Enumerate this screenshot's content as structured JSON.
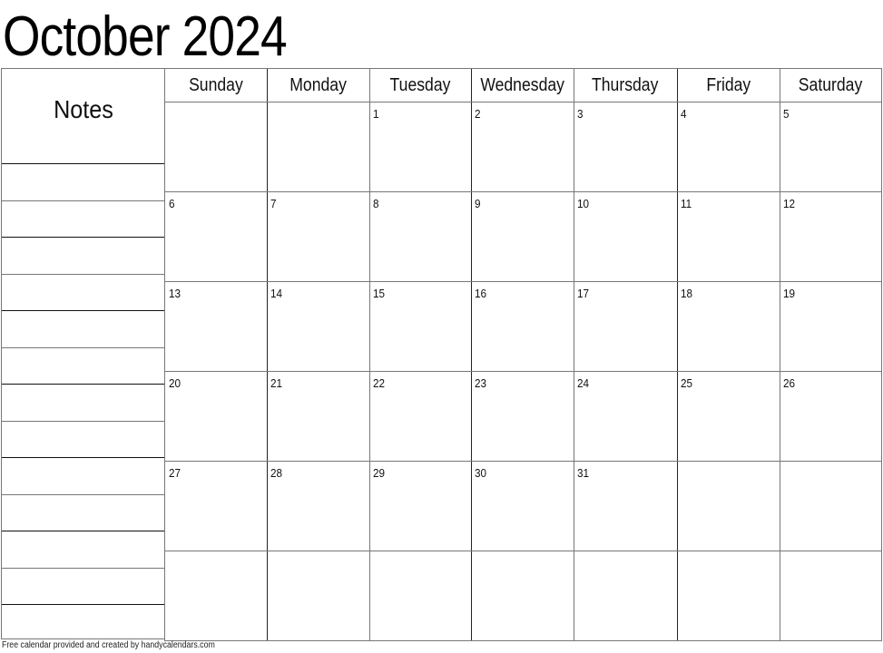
{
  "title": "October 2024",
  "notes": {
    "label": "Notes",
    "line_count": 13
  },
  "weekdays": [
    "Sunday",
    "Monday",
    "Tuesday",
    "Wednesday",
    "Thursday",
    "Friday",
    "Saturday"
  ],
  "weeks": [
    [
      "",
      "",
      "1",
      "2",
      "3",
      "4",
      "5"
    ],
    [
      "6",
      "7",
      "8",
      "9",
      "10",
      "11",
      "12"
    ],
    [
      "13",
      "14",
      "15",
      "16",
      "17",
      "18",
      "19"
    ],
    [
      "20",
      "21",
      "22",
      "23",
      "24",
      "25",
      "26"
    ],
    [
      "27",
      "28",
      "29",
      "30",
      "31",
      "",
      ""
    ],
    [
      "",
      "",
      "",
      "",
      "",
      "",
      ""
    ]
  ],
  "footer": "Free calendar provided and created by handycalendars.com",
  "colors": {
    "line_dark": "#111111",
    "line_gray": "#777777",
    "text": "#111111"
  }
}
